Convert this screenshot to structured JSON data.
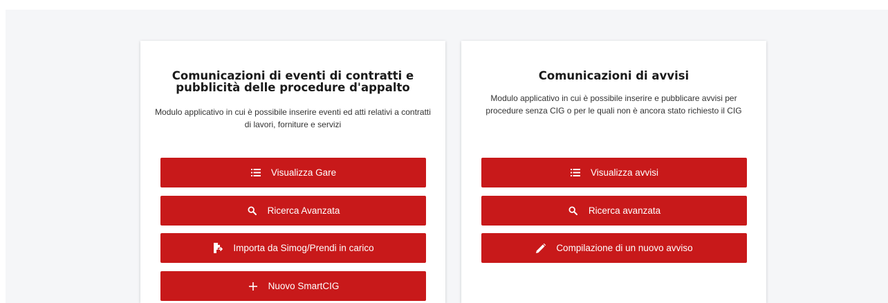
{
  "cards": [
    {
      "title": "Comunicazioni di eventi di contratti e pubblicità delle procedure d'appalto",
      "description": "Modulo applicativo in cui è possibile inserire eventi ed atti relativi a contratti di lavori, forniture e servizi",
      "buttons": [
        {
          "label": "Visualizza Gare",
          "icon": "list-icon"
        },
        {
          "label": "Ricerca Avanzata",
          "icon": "search-icon"
        },
        {
          "label": "Importa da Simog/Prendi in carico",
          "icon": "file-import-icon"
        },
        {
          "label": "Nuovo SmartCIG",
          "icon": "plus-icon"
        }
      ]
    },
    {
      "title": "Comunicazioni di avvisi",
      "description": "Modulo applicativo in cui è possibile inserire e pubblicare avvisi per procedure senza CIG o per le quali non è ancora stato richiesto il CIG",
      "buttons": [
        {
          "label": "Visualizza avvisi",
          "icon": "list-icon"
        },
        {
          "label": "Ricerca avanzata",
          "icon": "search-icon"
        },
        {
          "label": "Compilazione di un nuovo avviso",
          "icon": "pencil-icon"
        }
      ]
    }
  ],
  "colors": {
    "button_bg": "#c8191a",
    "button_text": "#ffffff",
    "page_bg": "#f5f6f8",
    "card_bg": "#ffffff"
  }
}
